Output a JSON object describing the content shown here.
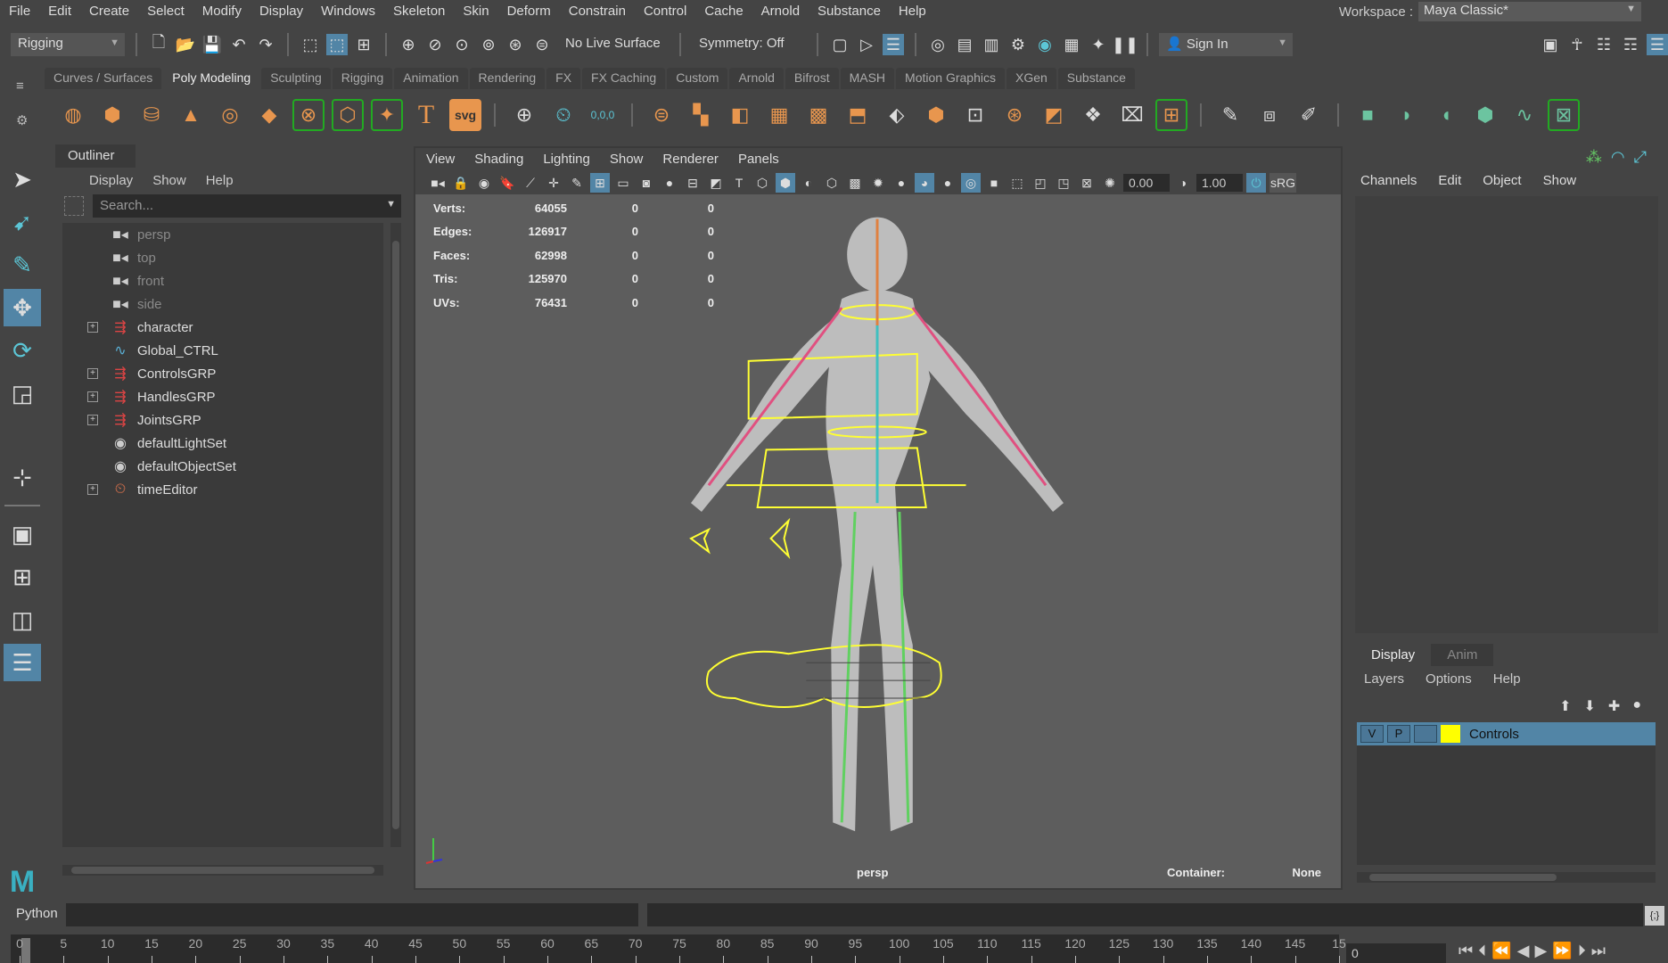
{
  "menubar": {
    "items": [
      "File",
      "Edit",
      "Create",
      "Select",
      "Modify",
      "Display",
      "Windows",
      "Skeleton",
      "Skin",
      "Deform",
      "Constrain",
      "Control",
      "Cache",
      "Arnold",
      "Substance",
      "Help"
    ],
    "workspace_label": "Workspace :",
    "workspace_value": "Maya Classic*"
  },
  "statusline": {
    "menuset": "Rigging",
    "live_surface": "No Live Surface",
    "symmetry": "Symmetry: Off",
    "sign_in": "Sign In"
  },
  "shelf": {
    "tabs": [
      "Curves / Surfaces",
      "Poly Modeling",
      "Sculpting",
      "Rigging",
      "Animation",
      "Rendering",
      "FX",
      "FX Caching",
      "Custom",
      "Arnold",
      "Bifrost",
      "MASH",
      "Motion Graphics",
      "XGen",
      "Substance"
    ],
    "active_tab": "Poly Modeling",
    "text_icon": "T",
    "svg_icon": "svg",
    "coord_icon": "0,0,0"
  },
  "outliner": {
    "title": "Outliner",
    "menu": [
      "Display",
      "Show",
      "Help"
    ],
    "search_placeholder": "Search...",
    "items": [
      {
        "label": "persp",
        "icon": "camera-icon",
        "expandable": false,
        "dim": true
      },
      {
        "label": "top",
        "icon": "camera-icon",
        "expandable": false,
        "dim": true
      },
      {
        "label": "front",
        "icon": "camera-icon",
        "expandable": false,
        "dim": true
      },
      {
        "label": "side",
        "icon": "camera-icon",
        "expandable": false,
        "dim": true
      },
      {
        "label": "character",
        "icon": "group-icon",
        "expandable": true,
        "dim": false
      },
      {
        "label": "Global_CTRL",
        "icon": "curve-icon",
        "expandable": false,
        "dim": false
      },
      {
        "label": "ControlsGRP",
        "icon": "group-icon",
        "expandable": true,
        "dim": false
      },
      {
        "label": "HandlesGRP",
        "icon": "group-icon",
        "expandable": true,
        "dim": false
      },
      {
        "label": "JointsGRP",
        "icon": "group-icon",
        "expandable": true,
        "dim": false
      },
      {
        "label": "defaultLightSet",
        "icon": "set-icon",
        "expandable": false,
        "dim": false
      },
      {
        "label": "defaultObjectSet",
        "icon": "set-icon",
        "expandable": false,
        "dim": false
      },
      {
        "label": "timeEditor",
        "icon": "time-editor-icon",
        "expandable": true,
        "dim": false
      }
    ]
  },
  "viewport": {
    "menu": [
      "View",
      "Shading",
      "Lighting",
      "Show",
      "Renderer",
      "Panels"
    ],
    "exposure": "0.00",
    "gamma": "1.00",
    "color_mgmt": "sRG",
    "hud": [
      {
        "label": "Verts:",
        "value": "64055",
        "sel": "0",
        "comp": "0"
      },
      {
        "label": "Edges:",
        "value": "126917",
        "sel": "0",
        "comp": "0"
      },
      {
        "label": "Faces:",
        "value": "62998",
        "sel": "0",
        "comp": "0"
      },
      {
        "label": "Tris:",
        "value": "125970",
        "sel": "0",
        "comp": "0"
      },
      {
        "label": "UVs:",
        "value": "76431",
        "sel": "0",
        "comp": "0"
      }
    ],
    "camera": "persp",
    "container_label": "Container:",
    "container_value": "None"
  },
  "channelbox": {
    "menu": [
      "Channels",
      "Edit",
      "Object",
      "Show"
    ]
  },
  "layers": {
    "tabs": [
      "Display",
      "Anim"
    ],
    "active_tab": "Display",
    "menu": [
      "Layers",
      "Options",
      "Help"
    ],
    "rows": [
      {
        "v": "V",
        "p": "P",
        "name": "Controls",
        "color": "#ffff00"
      }
    ]
  },
  "cmdline": {
    "language": "Python"
  },
  "timeline": {
    "ticks": [
      "0",
      "5",
      "10",
      "15",
      "20",
      "25",
      "30",
      "35",
      "40",
      "45",
      "50",
      "55",
      "60",
      "65",
      "70",
      "75",
      "80",
      "85",
      "90",
      "95",
      "100",
      "105",
      "110",
      "115",
      "120",
      "125",
      "130",
      "135",
      "140",
      "145",
      "15"
    ],
    "current_frame": "0"
  }
}
